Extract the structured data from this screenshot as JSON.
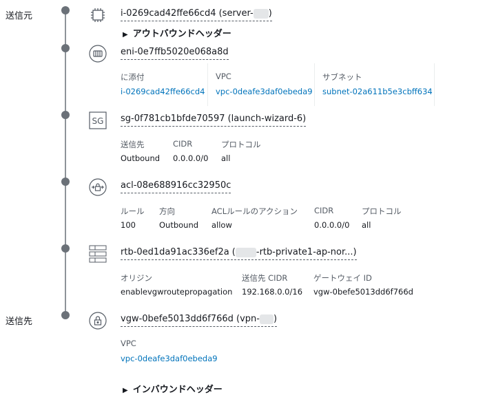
{
  "labels": {
    "source": "送信元",
    "destination": "送信先"
  },
  "outbound_header": "アウトバウンドヘッダー",
  "inbound_header": "インバウンドヘッダー",
  "instance": {
    "id": "i-0269cad42ffe66cd4",
    "name_prefix": "(server-",
    "name_suffix": ")",
    "icon": "chip-icon"
  },
  "eni": {
    "id": "eni-0e7ffb5020e068a8d",
    "icon": "network-interface-icon",
    "cols": [
      {
        "header": "に添付",
        "value": "i-0269cad42ffe66cd4"
      },
      {
        "header": "VPC",
        "value": "vpc-0deafe3daf0ebeda9"
      },
      {
        "header": "サブネット",
        "value": "subnet-02a611b5e3cbff634"
      }
    ]
  },
  "sg": {
    "id": "sg-0f781cb1bfde70597 (launch-wizard-6)",
    "icon_text": "SG",
    "headers": [
      "送信先",
      "CIDR",
      "プロトコル"
    ],
    "values": [
      "Outbound",
      "0.0.0.0/0",
      "all"
    ]
  },
  "acl": {
    "id": "acl-08e688916cc32950c",
    "icon": "acl-lock-icon",
    "headers": [
      "ルール",
      "方向",
      "ACLルールのアクション",
      "CIDR",
      "プロトコル"
    ],
    "values": [
      "100",
      "Outbound",
      "allow",
      "0.0.0.0/0",
      "all"
    ]
  },
  "rtb": {
    "id_prefix": "rtb-0ed1da91ac336ef2a (",
    "id_suffix": "-rtb-private1-ap-nor...)",
    "icon": "route-table-icon",
    "headers": [
      "オリジン",
      "送信先 CIDR",
      "ゲートウェイ ID"
    ],
    "values": [
      "enablevgwroutepropagation",
      "192.168.0.0/16",
      "vgw-0befe5013dd6f766d"
    ]
  },
  "vgw": {
    "id_prefix": "vgw-0befe5013dd6f766d (vpn-",
    "id_suffix": ")",
    "icon": "vpn-gateway-lock-icon",
    "header": "VPC",
    "value": "vpc-0deafe3daf0ebeda9"
  }
}
